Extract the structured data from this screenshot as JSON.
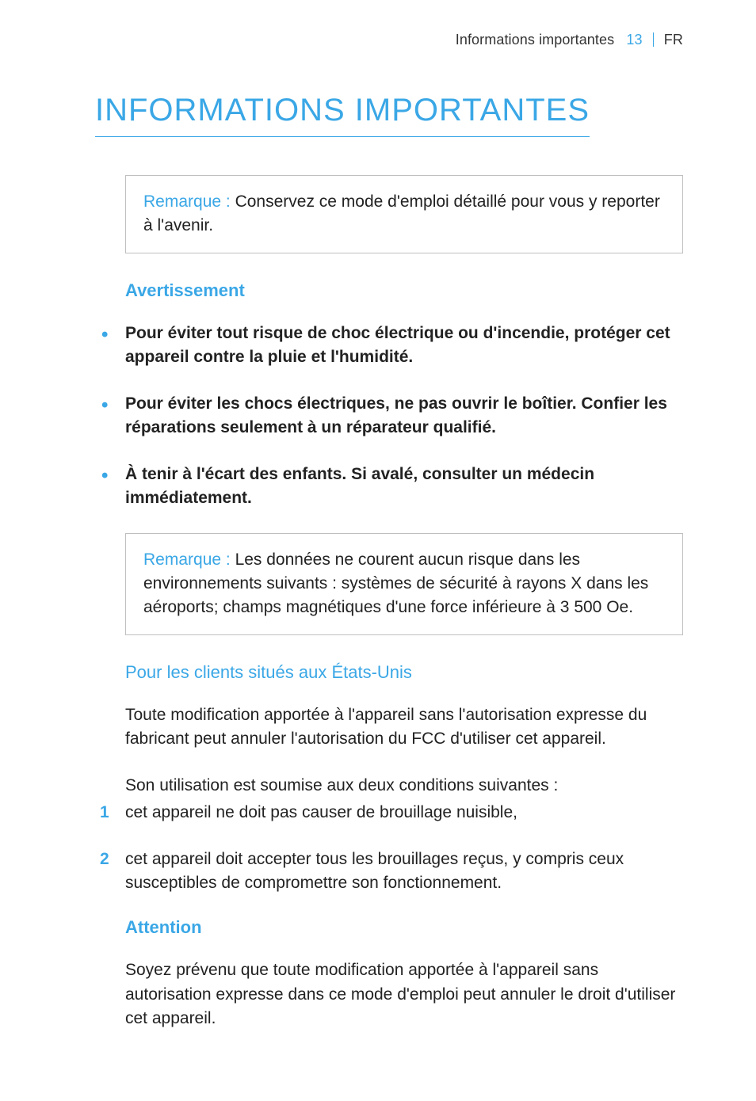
{
  "header": {
    "section_name": "Informations importantes",
    "page_number": "13",
    "language": "FR"
  },
  "title": "INFORMATIONS IMPORTANTES",
  "note1": {
    "label": "Remarque : ",
    "text": "Conservez ce mode d'emploi détaillé pour vous y reporter à l'avenir."
  },
  "warning_heading": "Avertissement",
  "warnings": [
    "Pour éviter tout risque de choc électrique ou d'incendie, protéger cet appareil contre la pluie et l'humidité.",
    "Pour éviter les chocs électriques, ne pas ouvrir le boîtier. Confier les réparations seulement à un réparateur qualifié.",
    "À tenir à l'écart des enfants. Si avalé, consulter un médecin immédiatement."
  ],
  "note2": {
    "label": "Remarque : ",
    "text": "Les données ne courent aucun risque dans les environnements suivants : systèmes de sécurité à rayons X dans les aéroports; champs magnétiques d'une force inférieure à 3 500 Oe."
  },
  "us_heading": "Pour les clients situés aux États-Unis",
  "us_para": "Toute modification apportée à l'appareil sans l'autorisation expresse du fabricant peut annuler l'autorisation du FCC d'utiliser cet appareil.",
  "conditions_intro": "Son utilisation est soumise aux deux conditions suivantes :",
  "conditions": [
    "cet appareil ne doit pas causer de brouillage nuisible,",
    "cet appareil doit accepter tous les brouillages reçus, y compris ceux susceptibles de compromettre son fonctionnement."
  ],
  "attention_heading": "Attention",
  "attention_para": "Soyez prévenu que toute modification apportée à l'appareil sans autorisation expresse dans ce mode d'emploi peut annuler le droit d'utiliser cet appareil."
}
